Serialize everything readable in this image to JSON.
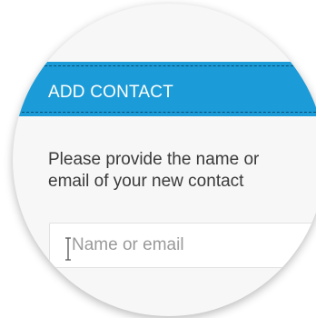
{
  "dialog": {
    "title": "ADD CONTACT",
    "description_line1": "Please provide the name or",
    "description_line2": "email of your new contact",
    "input": {
      "placeholder": "Name or email",
      "value": ""
    }
  },
  "colors": {
    "header": "#1b9bd7",
    "header_dash": "#0b4f75",
    "background": "#f7f7f7",
    "text": "#3a3a3a",
    "placeholder": "#9a9a9a"
  },
  "icons": {
    "cursor": "text-cursor-icon"
  }
}
